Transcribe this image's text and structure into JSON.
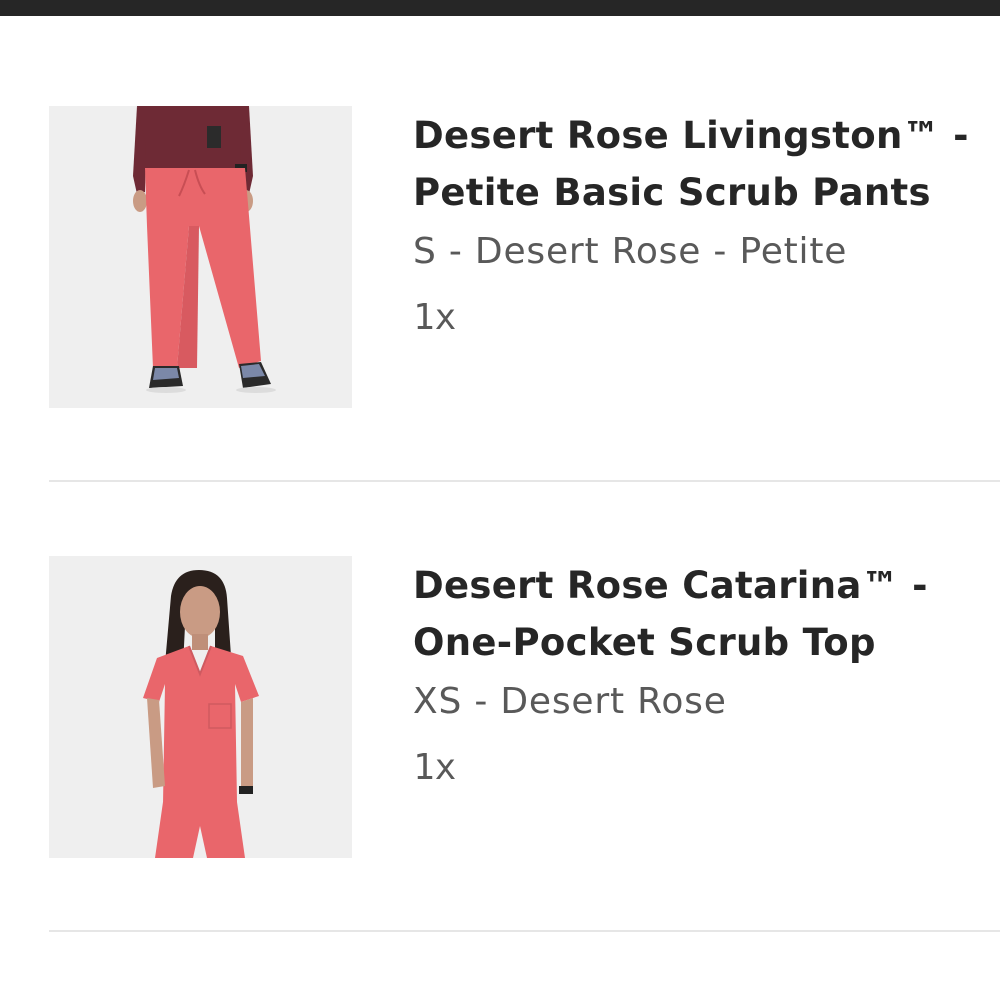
{
  "colors": {
    "top_bar": "#262626",
    "title_text": "#262626",
    "secondary_text": "#595959",
    "divider": "#e6e6e6",
    "product_color": "#e9666b"
  },
  "items": [
    {
      "image_icon": "product-photo-scrub-pants",
      "title_line1": "Desert Rose Livingston™ -",
      "title_line2": "Petite Basic Scrub Pants",
      "variant": "S - Desert Rose - Petite",
      "quantity": "1x"
    },
    {
      "image_icon": "product-photo-scrub-top",
      "title_line1": "Desert Rose Catarina™ -",
      "title_line2": "One-Pocket Scrub Top",
      "variant": "XS - Desert Rose",
      "quantity": "1x"
    }
  ]
}
